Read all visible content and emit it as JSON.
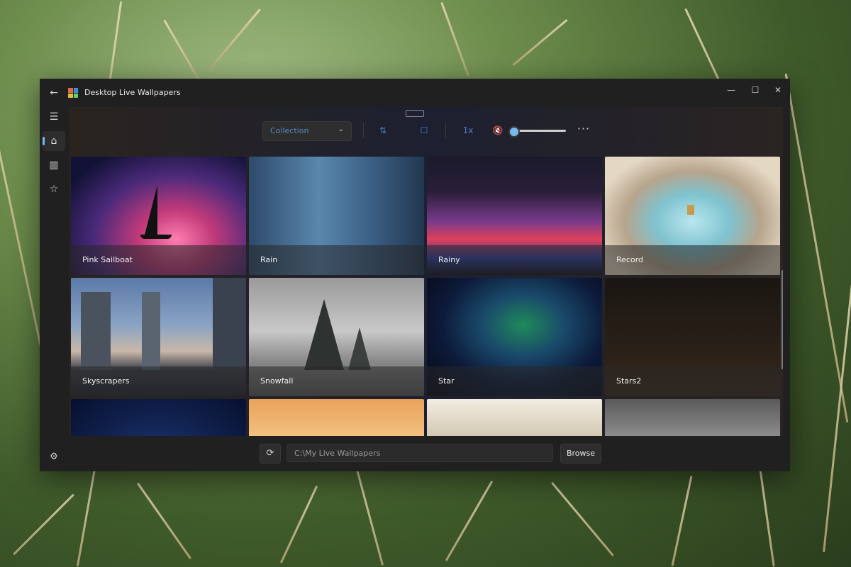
{
  "window": {
    "title": "Desktop Live Wallpapers",
    "controls": {
      "minimize": "—",
      "maximize": "☐",
      "close": "✕"
    },
    "back_glyph": "←"
  },
  "sidebar": {
    "items": [
      {
        "name": "menu",
        "icon": "hamburger-menu-icon",
        "glyph": "☰"
      },
      {
        "name": "home",
        "icon": "home-icon",
        "glyph": "⌂",
        "active": true
      },
      {
        "name": "library",
        "icon": "library-icon",
        "glyph": "▥"
      },
      {
        "name": "favorites",
        "icon": "star-icon",
        "glyph": "☆"
      }
    ],
    "settings_glyph": "⚙"
  },
  "toolbar": {
    "dropdown_label": "Collection",
    "dropdown_chevron": "⌄",
    "sort_glyph": "⇅",
    "fullscreen_glyph": "☐",
    "speed_label": "1x",
    "mute_glyph": "🔇",
    "volume_level": 0.0,
    "more_glyph": "···"
  },
  "wallpapers": [
    {
      "name": "Pink Sailboat"
    },
    {
      "name": "Rain"
    },
    {
      "name": "Rainy"
    },
    {
      "name": "Record"
    },
    {
      "name": "Skyscrapers"
    },
    {
      "name": "Snowfall"
    },
    {
      "name": "Star"
    },
    {
      "name": "Stars2"
    },
    {
      "name": ""
    },
    {
      "name": ""
    },
    {
      "name": ""
    },
    {
      "name": ""
    }
  ],
  "footer": {
    "refresh_glyph": "⟳",
    "path_value": "C:\\My Live Wallpapers",
    "browse_label": "Browse"
  },
  "colors": {
    "accent": "#76b9ed",
    "window_bg": "#202020"
  }
}
